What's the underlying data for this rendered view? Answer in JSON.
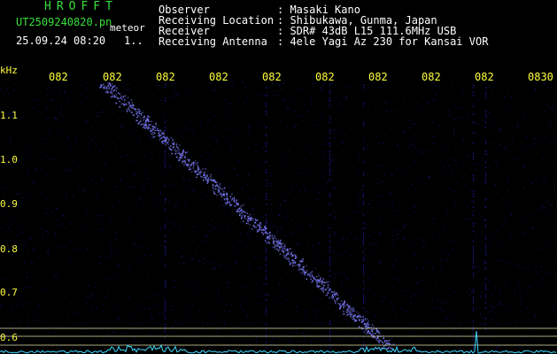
{
  "app": {
    "title": "HROFFT",
    "filename": "UT2509240820.pn",
    "mode_label": "meteor",
    "datetime": "25.09.24 08:20",
    "extra": "1.."
  },
  "info": [
    {
      "key": "Observer",
      "value": ": Masaki Kano"
    },
    {
      "key": "Receiving Location",
      "value": ": Shibukawa, Gunma, Japan"
    },
    {
      "key": "Receiver",
      "value": ": SDR# 43dB L15 111.6MHz USB"
    },
    {
      "key": "Receiving Antenna",
      "value": ": 4ele Yagi Az 230 for Kansai VOR"
    }
  ],
  "spectrogram": {
    "y_unit": "kHz",
    "x_ticks": [
      "082",
      "082",
      "082",
      "082",
      "082",
      "082",
      "082",
      "082",
      "082",
      "0830"
    ],
    "y_ticks": [
      "1.1",
      "1.0",
      "0.9",
      "0.8",
      "0.7",
      "0.6"
    ],
    "colors": {
      "background": "#000000",
      "noise": "#1a1aa0",
      "echo": "#7d7dff",
      "reference_lines": "#d8d8a0",
      "baseline_trace": "#3fd8ff",
      "title": "#36e23a",
      "ticks": "#ffff3a"
    }
  }
}
